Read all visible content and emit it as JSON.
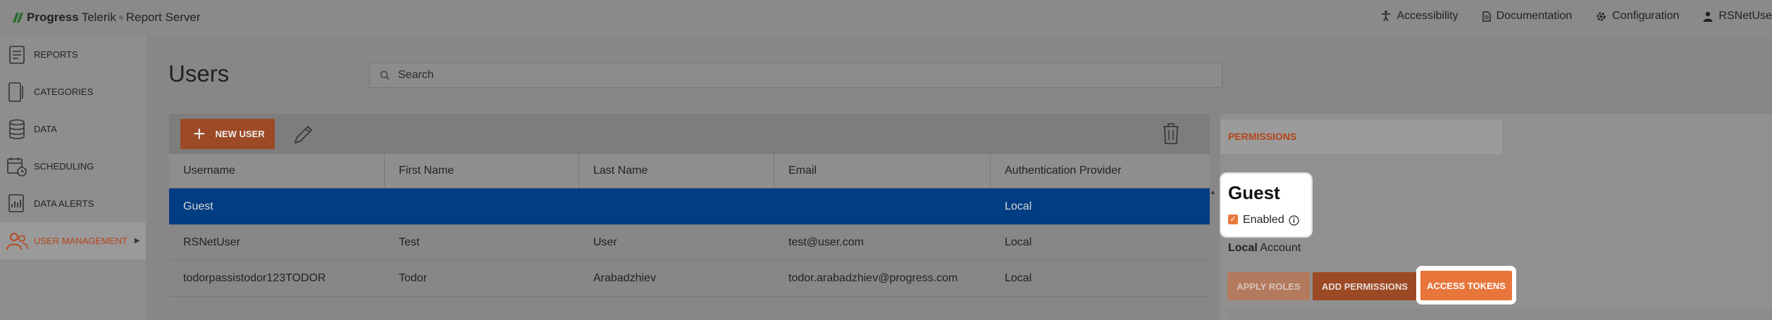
{
  "header": {
    "brand": "Progress",
    "product": "Telerik",
    "product_suffix": "Report Server",
    "nav": [
      {
        "label": "Accessibility",
        "icon": "accessibility-icon"
      },
      {
        "label": "Documentation",
        "icon": "document-icon"
      },
      {
        "label": "Configuration",
        "icon": "gear-icon"
      },
      {
        "label": "RSNetUse",
        "icon": "user-icon"
      }
    ]
  },
  "sidebar": {
    "items": [
      {
        "label": "REPORTS",
        "icon": "reports-icon"
      },
      {
        "label": "CATEGORIES",
        "icon": "categories-icon"
      },
      {
        "label": "DATA",
        "icon": "database-icon"
      },
      {
        "label": "SCHEDULING",
        "icon": "calendar-clock-icon"
      },
      {
        "label": "DATA ALERTS",
        "icon": "data-alert-icon"
      },
      {
        "label": "USER MANAGEMENT",
        "icon": "users-icon",
        "active": true
      }
    ]
  },
  "main": {
    "title": "Users",
    "search_placeholder": "Search",
    "new_user_label": "NEW USER",
    "table": {
      "columns": [
        "Username",
        "First Name",
        "Last Name",
        "Email",
        "Authentication Provider"
      ],
      "rows": [
        {
          "username": "Guest",
          "first_name": "",
          "last_name": "",
          "email": "",
          "provider": "Local",
          "selected": true
        },
        {
          "username": "RSNetUser",
          "first_name": "Test",
          "last_name": "User",
          "email": "test@user.com",
          "provider": "Local"
        },
        {
          "username": "todorpassistodor123TODOR",
          "first_name": "Todor",
          "last_name": "Arabadzhiev",
          "email": "todor.arabadzhiev@progress.com",
          "provider": "Local"
        }
      ]
    }
  },
  "panel": {
    "tab": "PERMISSIONS",
    "user_name": "Guest",
    "enabled_label": "Enabled",
    "enabled": true,
    "account_type": "Local",
    "account_suffix": "Account",
    "apply_roles": "APPLY ROLES",
    "add_permissions": "ADD PERMISSIONS",
    "access_tokens": "ACCESS TOKENS"
  },
  "colors": {
    "accent": "#e8763b",
    "selected_row": "#003d82",
    "active_sidebar_text": "#b5451a"
  }
}
